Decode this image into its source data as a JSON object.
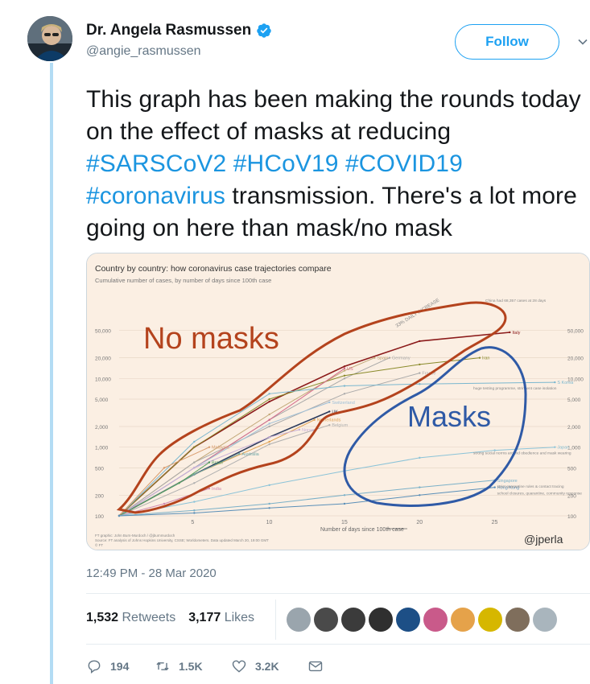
{
  "author": {
    "display_name": "Dr. Angela Rasmussen",
    "handle": "@angie_rasmussen",
    "verified": true
  },
  "follow_label": "Follow",
  "tweet": {
    "text_parts": [
      {
        "text": "This graph has been making the rounds today on the effect of masks at reducing ",
        "tag": false
      },
      {
        "text": "#SARSCoV2",
        "tag": true
      },
      {
        "text": " ",
        "tag": false
      },
      {
        "text": "#HCoV19",
        "tag": true
      },
      {
        "text": " ",
        "tag": false
      },
      {
        "text": "#COVID19",
        "tag": true
      },
      {
        "text": " ",
        "tag": false
      },
      {
        "text": "#coronavirus",
        "tag": true
      },
      {
        "text": " transmission. There's a lot more going on here than mask/no mask",
        "tag": false
      }
    ]
  },
  "media": {
    "chart_title": "Country by country: how coronavirus case trajectories compare",
    "chart_subtitle": "Cumulative number of cases, by number of days since 100th case",
    "annotation_no_masks": "No masks",
    "annotation_masks": "Masks",
    "watermark": "@jperla",
    "daily_increase_label": "33% DAILY INCREASE",
    "footer_lines": [
      "FT graphic: John Burn-Murdoch / @jburnmurdoch",
      "Source: FT analysis of Johns Hopkins University, CSSE; Worldometers. Data updated March 20, 19:00 GMT",
      "© FT"
    ],
    "country_labels": [
      {
        "name": "China",
        "note": "China had 68,357 cases at 28 days"
      },
      {
        "name": "Italy"
      },
      {
        "name": "Spain"
      },
      {
        "name": "Germany"
      },
      {
        "name": "Iran"
      },
      {
        "name": "France"
      },
      {
        "name": "US"
      },
      {
        "name": "S Korea",
        "note": "huge testing programme, stringent case isolation"
      },
      {
        "name": "Switzerland"
      },
      {
        "name": "UK"
      },
      {
        "name": "Netherlands"
      },
      {
        "name": "Belgium"
      },
      {
        "name": "Austria"
      },
      {
        "name": "Norway"
      },
      {
        "name": "Sweden"
      },
      {
        "name": "Denmark"
      },
      {
        "name": "Malaysia"
      },
      {
        "name": "Australia"
      },
      {
        "name": "Brazil"
      },
      {
        "name": "India"
      },
      {
        "name": "Japan",
        "note": "strong social norms around obedience and mask wearing"
      },
      {
        "name": "Singapore",
        "note": "strict quarantine rules & contact tracing"
      },
      {
        "name": "Hong Kong",
        "note": "school closures, quarantine, community response"
      }
    ],
    "chart_data": {
      "type": "line",
      "title": "Country by country: how coronavirus case trajectories compare",
      "subtitle": "Cumulative number of cases, by number of days since 100th case",
      "xlabel": "Number of days since 100th case",
      "ylabel": "",
      "y_scale": "log",
      "ylim": [
        100,
        100000
      ],
      "xlim": [
        0,
        30
      ],
      "x_ticks": [
        0,
        5,
        10,
        15,
        20,
        25
      ],
      "y_ticks": [
        100,
        200,
        500,
        1000,
        2000,
        5000,
        10000,
        20000,
        50000
      ],
      "y_tick_labels": [
        "100",
        "200",
        "500",
        "1,000",
        "2,000",
        "5,000",
        "10,000",
        "20,000",
        "50,000"
      ],
      "series": [
        {
          "name": "Italy",
          "color": "#8b1a1a",
          "x": [
            0,
            5,
            10,
            15,
            20,
            26
          ],
          "y": [
            100,
            1000,
            4600,
            15000,
            35000,
            47000
          ]
        },
        {
          "name": "Spain",
          "color": "#c2a878",
          "x": [
            0,
            5,
            10,
            15,
            17
          ],
          "y": [
            100,
            600,
            3000,
            13000,
            20000
          ]
        },
        {
          "name": "Germany",
          "color": "#a8a8a8",
          "x": [
            0,
            5,
            10,
            15,
            18
          ],
          "y": [
            100,
            500,
            2500,
            10000,
            20000
          ]
        },
        {
          "name": "Iran",
          "color": "#8a8a2a",
          "x": [
            0,
            5,
            10,
            15,
            20,
            24
          ],
          "y": [
            100,
            1000,
            5000,
            11000,
            16000,
            20000
          ]
        },
        {
          "name": "France",
          "color": "#aaaaaa",
          "x": [
            0,
            5,
            10,
            15,
            20
          ],
          "y": [
            100,
            600,
            2000,
            6000,
            12000
          ]
        },
        {
          "name": "US",
          "color": "#d36a8a",
          "x": [
            0,
            5,
            10,
            15
          ],
          "y": [
            100,
            500,
            2500,
            14000
          ]
        },
        {
          "name": "S Korea",
          "color": "#7ab7cf",
          "x": [
            0,
            5,
            10,
            15,
            20,
            29
          ],
          "y": [
            100,
            1200,
            6000,
            7800,
            8300,
            8800
          ]
        },
        {
          "name": "Switzerland",
          "color": "#9fc0d8",
          "x": [
            0,
            5,
            10,
            14
          ],
          "y": [
            100,
            500,
            2200,
            4500
          ]
        },
        {
          "name": "UK",
          "color": "#2b3a5c",
          "x": [
            0,
            5,
            10,
            14
          ],
          "y": [
            100,
            400,
            1400,
            3300
          ]
        },
        {
          "name": "Netherlands",
          "color": "#e0a050",
          "x": [
            0,
            5,
            10,
            13
          ],
          "y": [
            100,
            400,
            1200,
            2500
          ]
        },
        {
          "name": "Belgium",
          "color": "#b0b0b0",
          "x": [
            0,
            5,
            10,
            14
          ],
          "y": [
            100,
            300,
            1100,
            2100
          ]
        },
        {
          "name": "Norway",
          "color": "#c8b0d8",
          "x": [
            0,
            5,
            10,
            12
          ],
          "y": [
            100,
            500,
            1400,
            1800
          ]
        },
        {
          "name": "Malaysia",
          "color": "#d89a6a",
          "x": [
            0,
            3,
            6
          ],
          "y": [
            100,
            500,
            1000
          ]
        },
        {
          "name": "Australia",
          "color": "#6fa8a8",
          "x": [
            0,
            5,
            8
          ],
          "y": [
            100,
            400,
            800
          ]
        },
        {
          "name": "Brazil",
          "color": "#4f9b5a",
          "x": [
            0,
            4,
            6
          ],
          "y": [
            100,
            300,
            600
          ]
        },
        {
          "name": "India",
          "color": "#d08ab0",
          "x": [
            0,
            3,
            6
          ],
          "y": [
            100,
            150,
            250
          ]
        },
        {
          "name": "Japan",
          "color": "#8bc3d8",
          "x": [
            0,
            5,
            10,
            15,
            20,
            25,
            29
          ],
          "y": [
            100,
            160,
            280,
            450,
            700,
            900,
            1000
          ]
        },
        {
          "name": "Singapore",
          "color": "#7ab0c8",
          "x": [
            0,
            5,
            10,
            15,
            20,
            25
          ],
          "y": [
            100,
            120,
            150,
            200,
            260,
            330
          ]
        },
        {
          "name": "Hong Kong",
          "color": "#5a8fb8",
          "x": [
            0,
            5,
            10,
            15,
            20,
            25
          ],
          "y": [
            100,
            110,
            130,
            150,
            200,
            260
          ]
        }
      ]
    }
  },
  "timestamp": "12:49 PM - 28 Mar 2020",
  "stats": {
    "retweets_count": "1,532",
    "retweets_label": "Retweets",
    "likes_count": "3,177",
    "likes_label": "Likes"
  },
  "likers": [
    "#9aa5ad",
    "#4a4a4a",
    "#3b3b3b",
    "#2f2f2f",
    "#1d4f86",
    "#c95a8a",
    "#e5a24a",
    "#d6b700",
    "#7f6e5c",
    "#a9b5bd"
  ],
  "actions": {
    "reply_count": "194",
    "retweet_count": "1.5K",
    "like_count": "3.2K"
  },
  "colors": {
    "accent": "#1da1f2",
    "hashtag": "#1b95e0",
    "no_masks_outline": "#b4431d",
    "masks_outline": "#2f5aa6"
  }
}
